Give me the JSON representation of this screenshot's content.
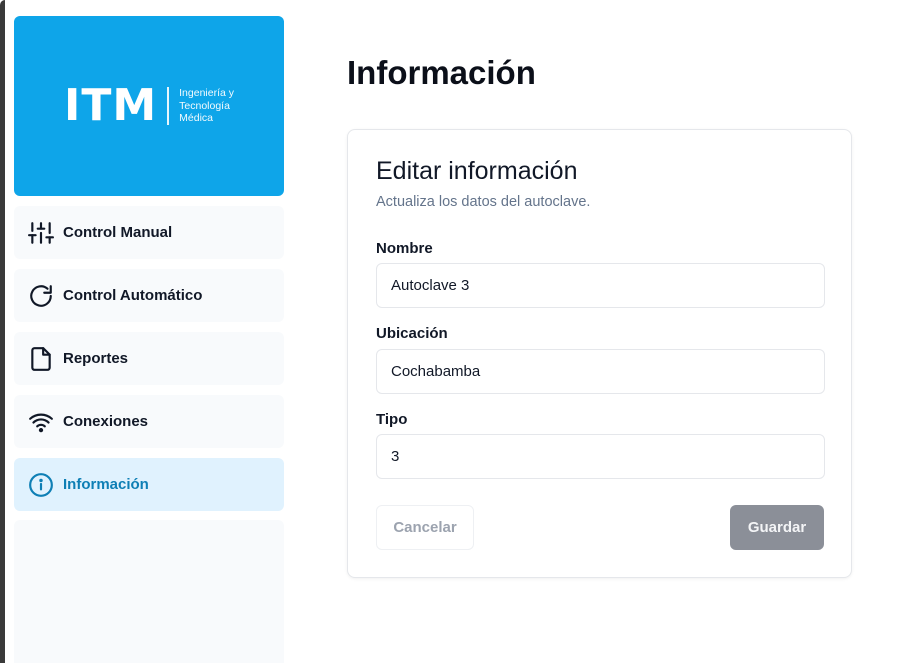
{
  "logo": {
    "text": "ITM",
    "subtitle_line1": "Ingeniería y",
    "subtitle_line2": "Tecnología",
    "subtitle_line3": "Médica",
    "background_color": "#0ea5e9"
  },
  "sidebar": {
    "items": [
      {
        "label": "Control Manual",
        "icon": "sliders-icon",
        "active": false
      },
      {
        "label": "Control Automático",
        "icon": "refresh-icon",
        "active": false
      },
      {
        "label": "Reportes",
        "icon": "file-icon",
        "active": false
      },
      {
        "label": "Conexiones",
        "icon": "wifi-icon",
        "active": false
      },
      {
        "label": "Información",
        "icon": "info-icon",
        "active": true
      }
    ],
    "active_color": "#0e7fb5",
    "active_background": "#e0f2fe"
  },
  "main": {
    "title": "Información",
    "card": {
      "title": "Editar información",
      "description": "Actualiza los datos del autoclave.",
      "fields": [
        {
          "label": "Nombre",
          "value": "Autoclave 3"
        },
        {
          "label": "Ubicación",
          "value": "Cochabamba"
        },
        {
          "label": "Tipo",
          "value": "3"
        }
      ],
      "cancel_label": "Cancelar",
      "save_label": "Guardar"
    }
  }
}
